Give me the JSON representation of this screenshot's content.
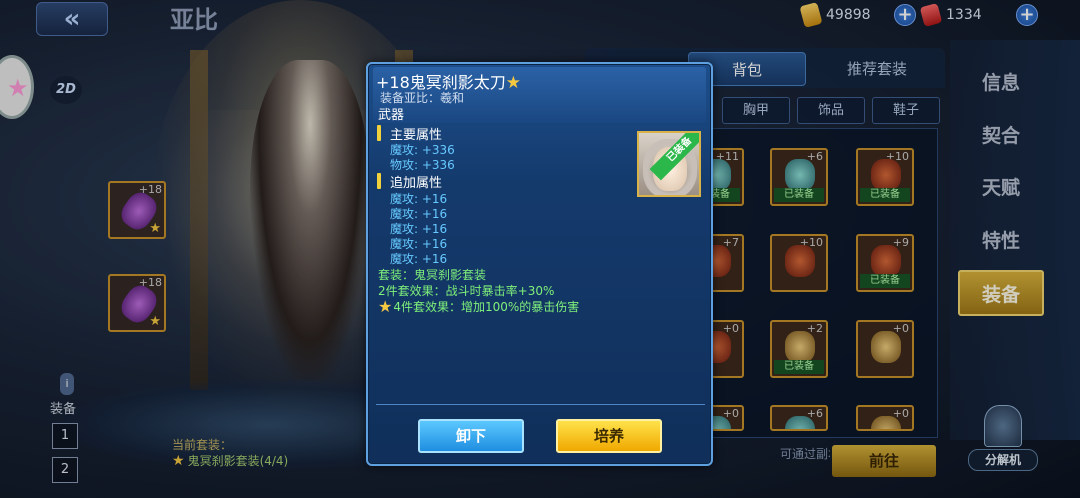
{
  "header": {
    "title": "亚比",
    "gold": "49898",
    "gems": "1334"
  },
  "left": {
    "mode_badge": "2D",
    "slot1_level": "+18",
    "slot2_level": "+18",
    "side_label": "装备",
    "page_buttons": [
      "1",
      "2"
    ],
    "set_label": "当前套装：",
    "set_progress": "鬼冥刹影套装(4/4)"
  },
  "bag": {
    "tab_bag": "背包",
    "tab_suggest": "推荐套装",
    "filters": [
      "胸甲",
      "饰品",
      "鞋子"
    ],
    "items": [
      {
        "level": "+11",
        "tag": "已装备",
        "style": "teal"
      },
      {
        "level": "+6",
        "tag": "已装备",
        "style": "teal"
      },
      {
        "level": "+10",
        "tag": "已装备",
        "style": "red"
      },
      {
        "level": "+7",
        "tag": "",
        "style": "red"
      },
      {
        "level": "+10",
        "tag": "",
        "style": "red"
      },
      {
        "level": "+9",
        "tag": "已装备",
        "style": "red"
      },
      {
        "level": "+0",
        "tag": "",
        "style": "red"
      },
      {
        "level": "+2",
        "tag": "已装备",
        "style": "gold"
      },
      {
        "level": "+0",
        "tag": "",
        "style": "gold"
      },
      {
        "level": "+0",
        "tag": "",
        "style": "teal"
      },
      {
        "level": "+6",
        "tag": "",
        "style": "teal"
      },
      {
        "level": "+0",
        "tag": "",
        "style": "gold"
      }
    ],
    "bottom_hint": "可通过副本和装备祈愿获得。",
    "goto_button": "前往"
  },
  "menu": {
    "items": [
      "信息",
      "契合",
      "天赋",
      "特性",
      "装备"
    ],
    "active": "装备",
    "machine_label": "分解机"
  },
  "dialog": {
    "title": "+18鬼冥刹影太刀",
    "owner": "装备亚比：羲和",
    "type": "武器",
    "main_title": "主要属性",
    "main_stats": [
      "魔攻: +336",
      "物攻: +336"
    ],
    "extra_title": "追加属性",
    "extra_stats": [
      "魔攻: +16",
      "魔攻: +16",
      "魔攻: +16",
      "魔攻: +16",
      "魔攻: +16"
    ],
    "set_name": "套装：鬼冥刹影套装",
    "set_effect_2": "2件套效果：战斗时暴击率+30%",
    "set_effect_4": "4件套效果：增加100%的暴击伤害",
    "equipped_ribbon": "已装备",
    "unequip_button": "卸下",
    "nurture_button": "培养"
  },
  "colors": {
    "accent_blue": "#1f8ee0",
    "accent_yellow": "#f0a800",
    "stat_blue": "#66c9ff",
    "set_green": "#7ff07a",
    "gold_frame": "#c9932a"
  }
}
